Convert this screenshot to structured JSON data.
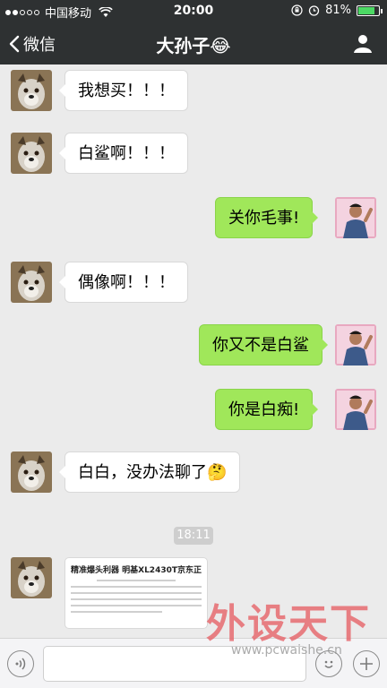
{
  "status_bar": {
    "carrier": "中国移动",
    "time": "20:00",
    "battery_percent": "81%",
    "battery_level": 0.81
  },
  "nav": {
    "back_label": "微信",
    "title": "大孙子😂"
  },
  "messages": [
    {
      "side": "left",
      "text": "我想买！！！"
    },
    {
      "side": "left",
      "text": "白鲨啊！！！"
    },
    {
      "side": "right",
      "text": "关你毛事!"
    },
    {
      "side": "left",
      "text": "偶像啊！！！"
    },
    {
      "side": "right",
      "text": "你又不是白鲨"
    },
    {
      "side": "right",
      "text": "你是白痴!"
    },
    {
      "side": "left",
      "text": "白白，没办法聊了🤔"
    }
  ],
  "timestamp": "18:11",
  "shared_card": {
    "title": "精准爆头利器 明基XL2430T京东正特价"
  },
  "watermark": {
    "logo_text": "外设天下",
    "url": "www.pcwaishe.cn"
  },
  "colors": {
    "bar_bg": "#2e3132",
    "green_bubble": "#a0e75a",
    "chat_bg": "#ebebeb"
  }
}
